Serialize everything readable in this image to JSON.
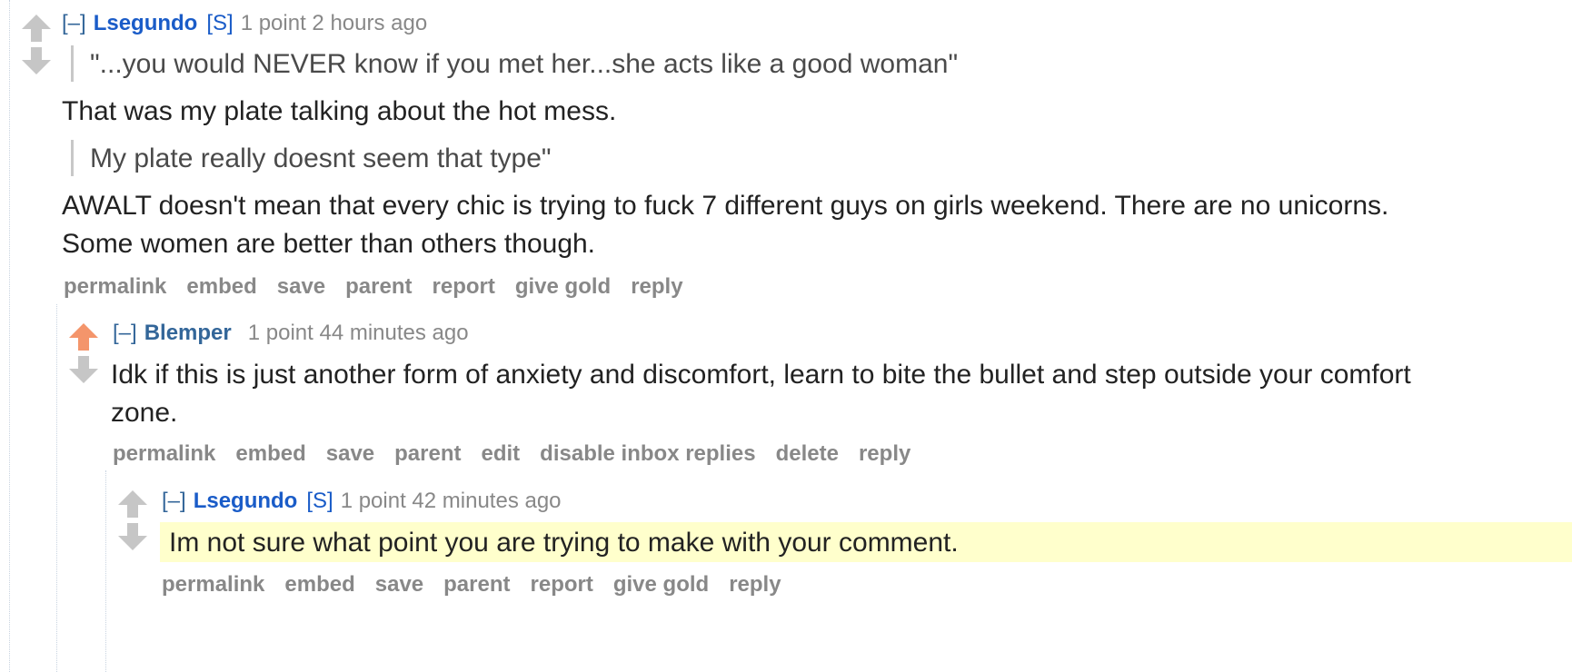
{
  "comment1": {
    "collapse": "[–]",
    "author": "Lsegundo",
    "submitter_tag": "[S]",
    "score": "1 point",
    "time": "2 hours ago",
    "quote1": "\"...you would NEVER know if you met her...she acts like a good woman\"",
    "para1": "That was my plate talking about the hot mess.",
    "quote2": "My plate really doesnt seem that type\"",
    "para2": "AWALT doesn't mean that every chic is trying to fuck 7 different guys on girls weekend. There are no unicorns. Some women are better than others though.",
    "buttons": [
      "permalink",
      "embed",
      "save",
      "parent",
      "report",
      "give gold",
      "reply"
    ],
    "vote_state": "none"
  },
  "comment2": {
    "collapse": "[–]",
    "author": "Blemper",
    "score": "1 point",
    "time": "44 minutes ago",
    "para1": "Idk if this is just another form of anxiety and discomfort, learn to bite the bullet and step outside your comfort zone.",
    "buttons": [
      "permalink",
      "embed",
      "save",
      "parent",
      "edit",
      "disable inbox replies",
      "delete",
      "reply"
    ],
    "vote_state": "upvoted"
  },
  "comment3": {
    "collapse": "[–]",
    "author": "Lsegundo",
    "submitter_tag": "[S]",
    "score": "1 point",
    "time": "42 minutes ago",
    "para1": "Im not sure what point you are trying to make with your comment.",
    "buttons": [
      "permalink",
      "embed",
      "save",
      "parent",
      "report",
      "give gold",
      "reply"
    ],
    "vote_state": "none"
  },
  "colors": {
    "upvote_active": "#f4956b",
    "arrow_inactive": "#c6c6c6",
    "author": "#1a5cc8",
    "highlight": "#ffffcc"
  }
}
